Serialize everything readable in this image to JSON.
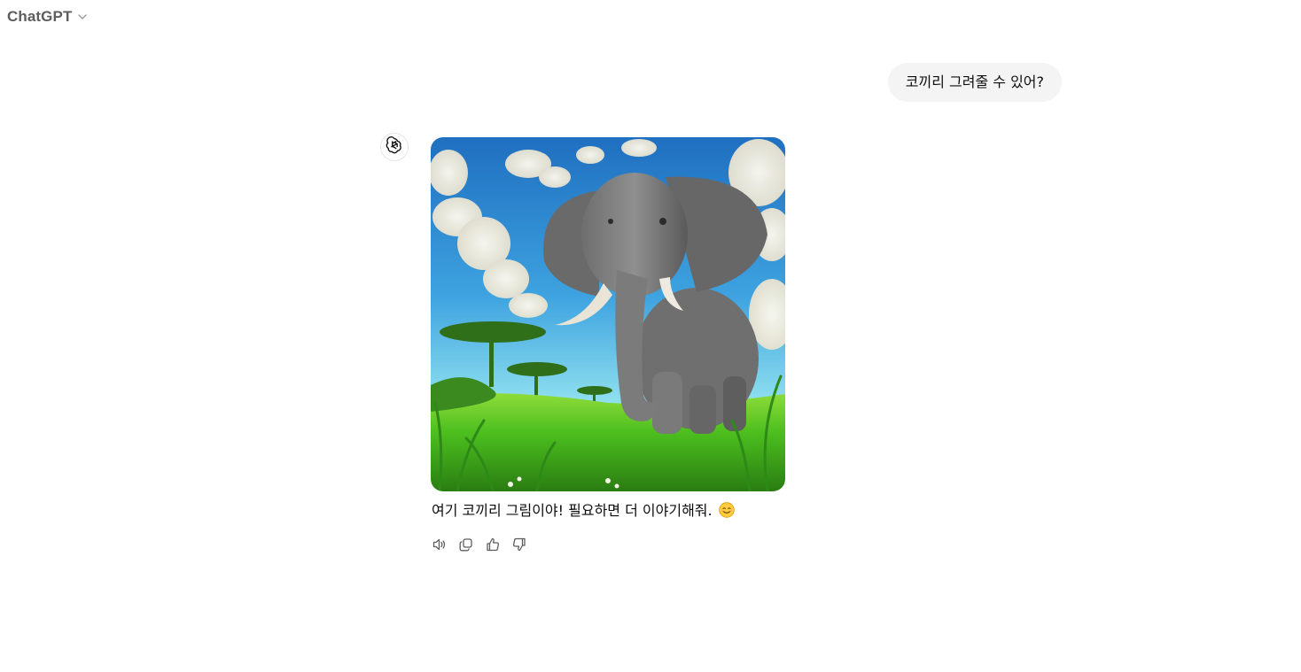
{
  "header": {
    "model_name": "ChatGPT",
    "chevron_icon": "chevron-down-icon"
  },
  "conversation": {
    "user_message": "코끼리 그려줄 수 있어?",
    "assistant": {
      "avatar_icon": "openai-logo-icon",
      "image_subject": "elephant",
      "text": "여기 코끼리 그림이야! 필요하면 더 이야기해줘.",
      "emoji": "smiling-face-emoji",
      "actions": [
        {
          "name": "read-aloud",
          "icon": "speaker-icon"
        },
        {
          "name": "copy",
          "icon": "copy-icon"
        },
        {
          "name": "good-response",
          "icon": "thumbs-up-icon"
        },
        {
          "name": "bad-response",
          "icon": "thumbs-down-icon"
        }
      ]
    }
  },
  "colors": {
    "user_bubble_bg": "#f4f4f4",
    "header_text": "#5d5d5d",
    "icon_gray": "#5d5d5d"
  }
}
